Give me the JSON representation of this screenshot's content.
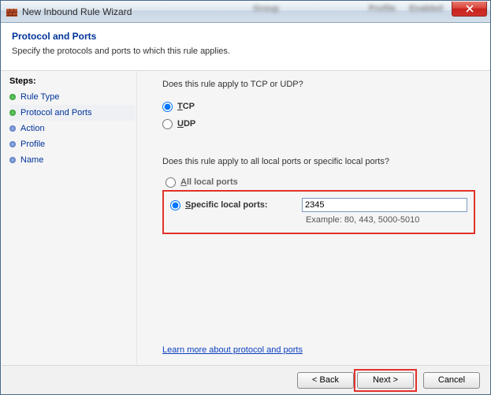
{
  "window": {
    "title": "New Inbound Rule Wizard"
  },
  "header": {
    "title": "Protocol and Ports",
    "subtitle": "Specify the protocols and ports to which this rule applies."
  },
  "sidebar": {
    "heading": "Steps:",
    "items": [
      {
        "label": "Rule Type"
      },
      {
        "label": "Protocol and Ports"
      },
      {
        "label": "Action"
      },
      {
        "label": "Profile"
      },
      {
        "label": "Name"
      }
    ]
  },
  "content": {
    "q1": "Does this rule apply to TCP or UDP?",
    "tcp": {
      "prefix": "T",
      "rest": "CP"
    },
    "udp": {
      "prefix": "U",
      "rest": "DP"
    },
    "q2": "Does this rule apply to all local ports or specific local ports?",
    "all_local": {
      "prefix": "A",
      "rest": "ll local ports"
    },
    "specific": {
      "prefix": "S",
      "rest": "pecific local ports:"
    },
    "port_value": "2345",
    "example": "Example: 80, 443, 5000-5010",
    "learn_more": "Learn more about protocol and ports"
  },
  "footer": {
    "back": "< Back",
    "next": "Next >",
    "cancel": "Cancel"
  }
}
